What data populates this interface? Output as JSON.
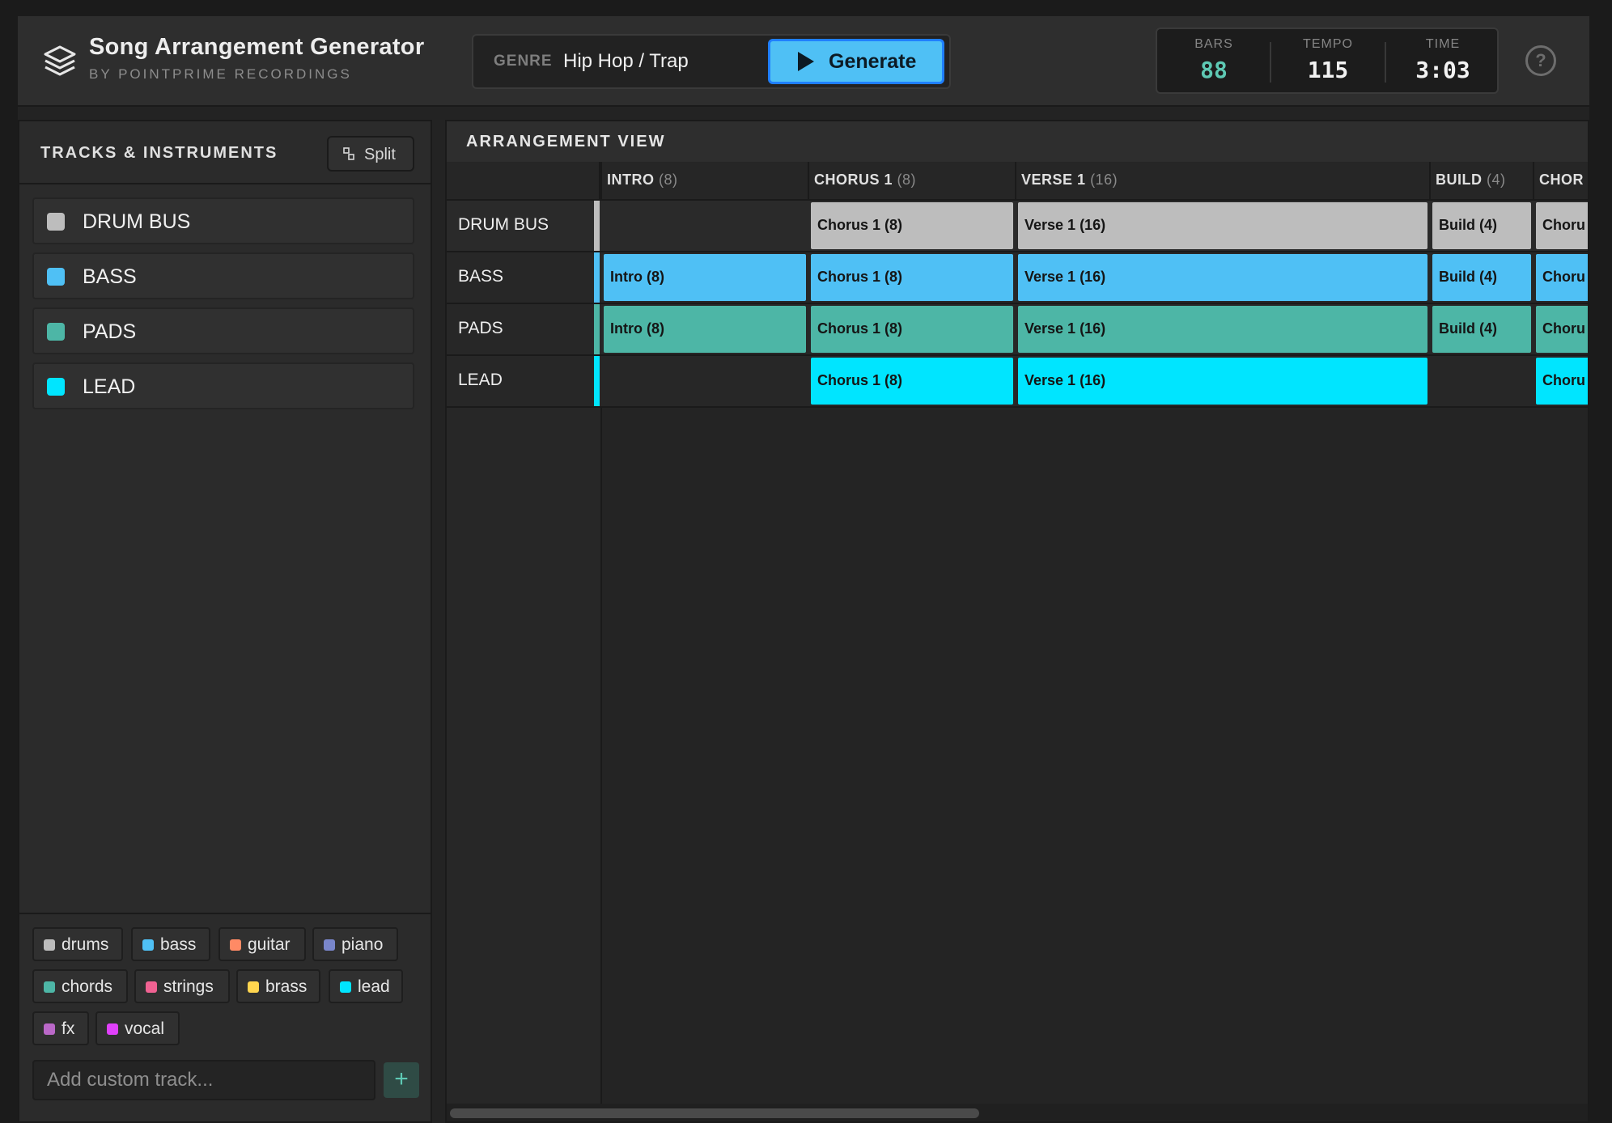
{
  "header": {
    "title": "Song Arrangement Generator",
    "subtitle": "BY POINTPRIME RECORDINGS",
    "genre_label": "GENRE",
    "genre_value": "Hip Hop / Trap",
    "generate_label": "Generate",
    "stats": [
      {
        "label": "BARS",
        "value": "88"
      },
      {
        "label": "TEMPO",
        "value": "115"
      },
      {
        "label": "TIME",
        "value": "3:03"
      }
    ],
    "help_glyph": "?"
  },
  "tracks_panel": {
    "title": "TRACKS & INSTRUMENTS",
    "split_label": "Split",
    "tracks": [
      {
        "name": "DRUM BUS",
        "color": "#bdbdbd"
      },
      {
        "name": "BASS",
        "color": "#4fc0f5"
      },
      {
        "name": "PADS",
        "color": "#4db6a6"
      },
      {
        "name": "LEAD",
        "color": "#00e5ff"
      }
    ],
    "presets": [
      {
        "name": "drums",
        "color": "#bdbdbd"
      },
      {
        "name": "bass",
        "color": "#4fc0f5"
      },
      {
        "name": "guitar",
        "color": "#ff8a65"
      },
      {
        "name": "piano",
        "color": "#7986cb"
      },
      {
        "name": "chords",
        "color": "#4db6a6"
      },
      {
        "name": "strings",
        "color": "#f06292"
      },
      {
        "name": "brass",
        "color": "#ffd54f"
      },
      {
        "name": "lead",
        "color": "#00e5ff"
      },
      {
        "name": "fx",
        "color": "#ba68c8"
      },
      {
        "name": "vocal",
        "color": "#e040fb"
      }
    ],
    "add_placeholder": "Add custom track...",
    "add_glyph": "+"
  },
  "arrangement": {
    "title": "ARRANGEMENT VIEW",
    "sections": [
      {
        "name": "INTRO",
        "bars": "(8)"
      },
      {
        "name": "CHORUS 1",
        "bars": "(8)"
      },
      {
        "name": "VERSE 1",
        "bars": "(16)"
      },
      {
        "name": "BUILD",
        "bars": "(4)"
      },
      {
        "name": "CHOR",
        "bars": ""
      }
    ],
    "rows": [
      {
        "track": "DRUM BUS",
        "color": "#bdbdbd",
        "clips": [
          "",
          "Chorus 1 (8)",
          "Verse 1 (16)",
          "Build (4)",
          "Choru"
        ]
      },
      {
        "track": "BASS",
        "color": "#4fc0f5",
        "clips": [
          "Intro (8)",
          "Chorus 1 (8)",
          "Verse 1 (16)",
          "Build (4)",
          "Choru"
        ]
      },
      {
        "track": "PADS",
        "color": "#4db6a6",
        "clips": [
          "Intro (8)",
          "Chorus 1 (8)",
          "Verse 1 (16)",
          "Build (4)",
          "Choru"
        ]
      },
      {
        "track": "LEAD",
        "color": "#00e5ff",
        "clips": [
          "",
          "Chorus 1 (8)",
          "Verse 1 (16)",
          "",
          "Choru"
        ]
      }
    ]
  }
}
